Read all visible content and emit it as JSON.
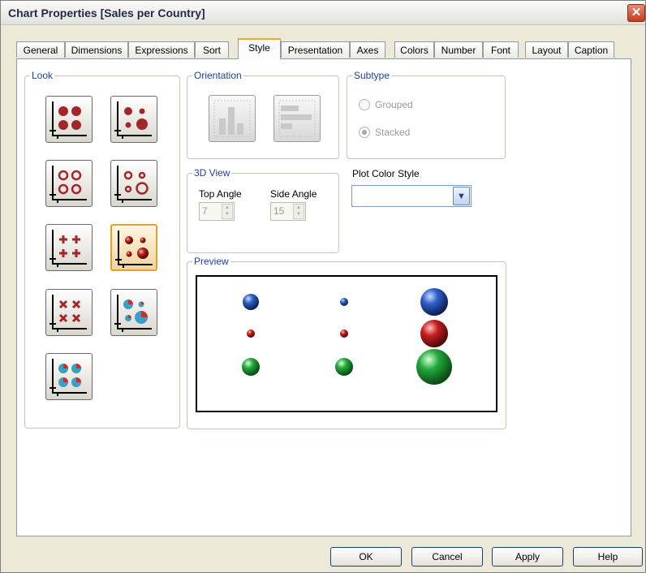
{
  "window": {
    "title": "Chart Properties [Sales per Country]",
    "close_glyph": "✕"
  },
  "tabs": [
    {
      "label": "General"
    },
    {
      "label": "Dimensions"
    },
    {
      "label": "Expressions"
    },
    {
      "label": "Sort"
    },
    {
      "label": "Style",
      "active": true
    },
    {
      "label": "Presentation"
    },
    {
      "label": "Axes"
    },
    {
      "label": "Colors"
    },
    {
      "label": "Number"
    },
    {
      "label": "Font"
    },
    {
      "label": "Layout"
    },
    {
      "label": "Caption"
    }
  ],
  "look": {
    "label": "Look",
    "options": [
      {
        "icon": "filled-dots-grid-icon"
      },
      {
        "icon": "filled-dots-sized-icon"
      },
      {
        "icon": "ring-dots-grid-icon"
      },
      {
        "icon": "ring-dots-sized-icon"
      },
      {
        "icon": "plus-markers-icon"
      },
      {
        "icon": "3d-balls-icon",
        "selected": true
      },
      {
        "icon": "x-markers-icon"
      },
      {
        "icon": "pie-bubbles-sized-icon"
      },
      {
        "icon": "pie-bubbles-grid-icon"
      }
    ]
  },
  "orientation": {
    "label": "Orientation",
    "options": [
      {
        "icon": "vertical-bars-icon"
      },
      {
        "icon": "horizontal-bars-icon"
      }
    ]
  },
  "subtype": {
    "label": "Subtype",
    "grouped": "Grouped",
    "stacked": "Stacked",
    "selected": "Stacked"
  },
  "view3d": {
    "label": "3D View",
    "top_angle_label": "Top Angle",
    "top_angle": "7",
    "side_angle_label": "Side Angle",
    "side_angle": "15"
  },
  "plot_color_style": {
    "label": "Plot Color Style",
    "value": ""
  },
  "preview": {
    "label": "Preview"
  },
  "buttons": {
    "ok": "OK",
    "cancel": "Cancel",
    "apply": "Apply",
    "help": "Help"
  },
  "colors": {
    "accent_tab": "#f5a623",
    "group_label": "#1f3f9a",
    "marker_red": "#a3262a",
    "ball_blue": "#2d5fc8",
    "ball_red": "#c81e1e",
    "ball_green": "#22a83a"
  }
}
